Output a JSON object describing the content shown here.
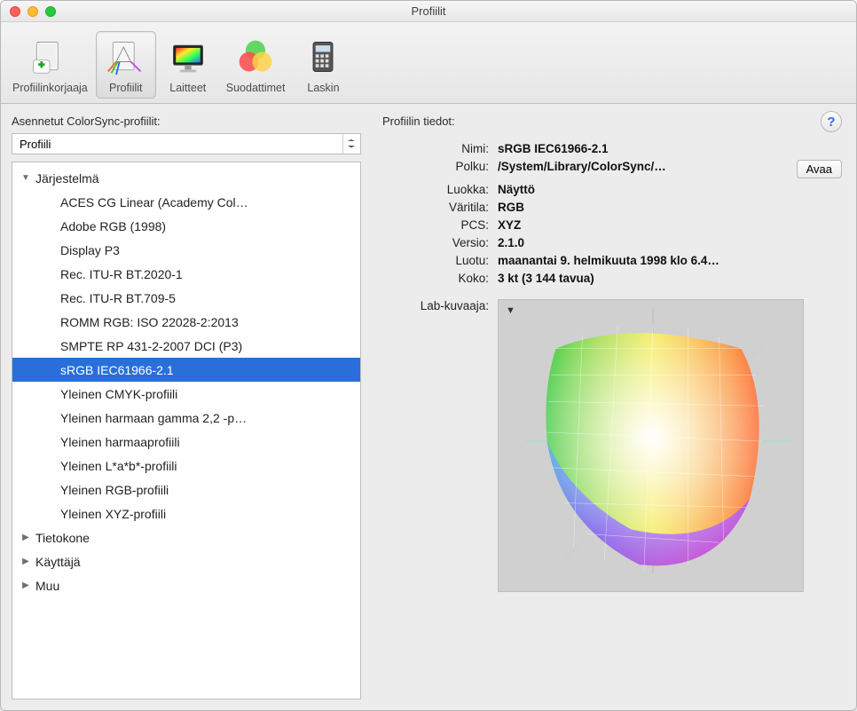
{
  "window": {
    "title": "Profiilit"
  },
  "toolbar": {
    "items": [
      {
        "label": "Profiilinkorjaaja",
        "icon": "firstaid-icon"
      },
      {
        "label": "Profiilit",
        "icon": "prism-icon"
      },
      {
        "label": "Laitteet",
        "icon": "monitor-icon"
      },
      {
        "label": "Suodattimet",
        "icon": "circles-icon"
      },
      {
        "label": "Laskin",
        "icon": "calculator-icon"
      }
    ],
    "selected_index": 1
  },
  "left": {
    "heading": "Asennetut ColorSync-profiilit:",
    "select_label": "Profiili",
    "tree": {
      "groups": [
        {
          "label": "Järjestelmä",
          "expanded": true,
          "items": [
            "ACES CG Linear (Academy Col…",
            "Adobe RGB (1998)",
            "Display P3",
            "Rec. ITU-R BT.2020-1",
            "Rec. ITU-R BT.709-5",
            "ROMM RGB: ISO 22028-2:2013",
            "SMPTE RP 431-2-2007 DCI (P3)",
            "sRGB IEC61966-2.1",
            "Yleinen CMYK-profiili",
            "Yleinen harmaan gamma 2,2 -p…",
            "Yleinen harmaaprofiili",
            "Yleinen L*a*b*-profiili",
            "Yleinen RGB-profiili",
            "Yleinen XYZ-profiili"
          ],
          "selected_index": 7
        },
        {
          "label": "Tietokone",
          "expanded": false,
          "items": []
        },
        {
          "label": "Käyttäjä",
          "expanded": false,
          "items": []
        },
        {
          "label": "Muu",
          "expanded": false,
          "items": []
        }
      ]
    }
  },
  "right": {
    "heading": "Profiilin tiedot:",
    "labels": {
      "name": "Nimi:",
      "path": "Polku:",
      "class": "Luokka:",
      "space": "Väritila:",
      "pcs": "PCS:",
      "version": "Versio:",
      "created": "Luotu:",
      "size": "Koko:",
      "lab": "Lab-kuvaaja:"
    },
    "values": {
      "name": "sRGB IEC61966-2.1",
      "path": "/System/Library/ColorSync/…",
      "class": "Näyttö",
      "space": "RGB",
      "pcs": "XYZ",
      "version": "2.1.0",
      "created": "maanantai 9. helmikuuta 1998 klo 6.4…",
      "size": "3 kt (3 144 tavua)"
    },
    "open_button": "Avaa",
    "help_tooltip": "?"
  }
}
